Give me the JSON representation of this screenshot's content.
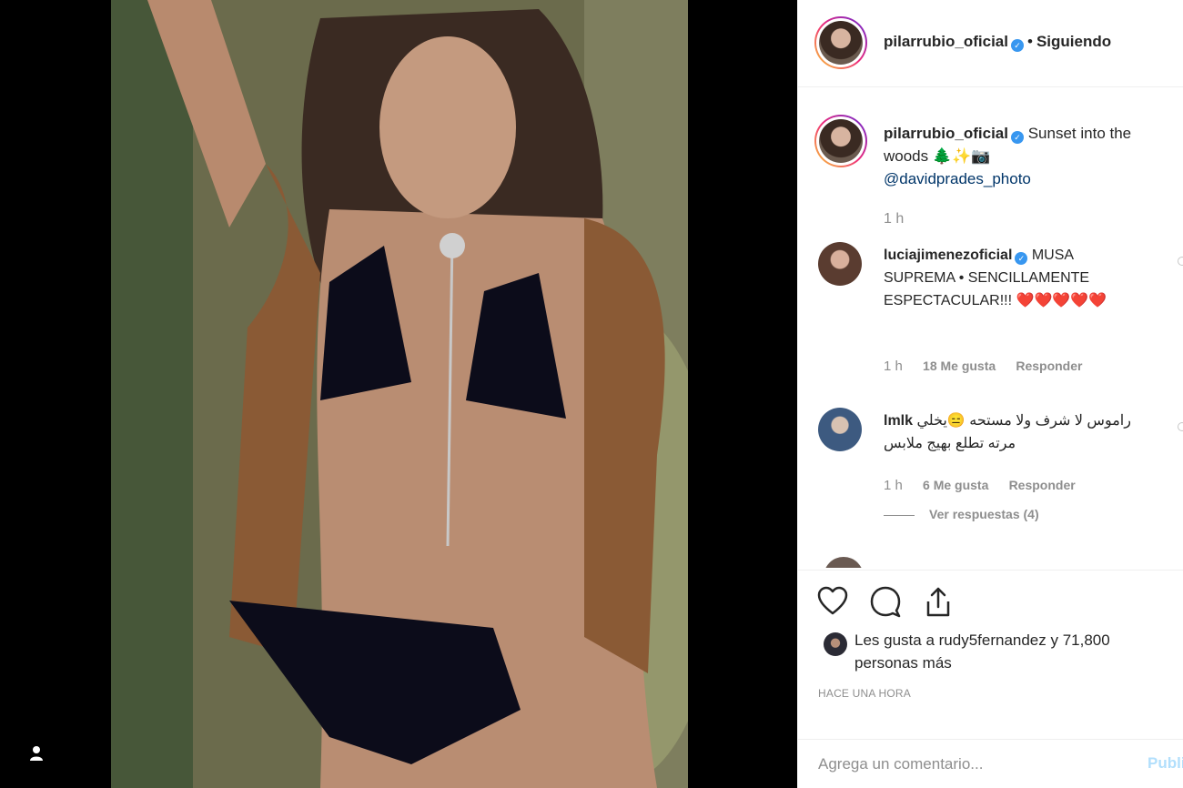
{
  "post": {
    "photo_alt": "",
    "author": {
      "username": "pilarrubio_oficial",
      "verified": true,
      "follow_status": "Siguiendo"
    },
    "caption": {
      "username": "pilarrubio_oficial",
      "text": "Sunset into the woods 🌲✨📷",
      "mention": "@davidprades_photo",
      "time": "1 h"
    },
    "comments": [
      {
        "username": "luciajimenezoficial",
        "verified": true,
        "text": "MUSA SUPREMA • SENCILLAMENTE ESPECTACULAR!!! ❤️❤️❤️❤️❤️",
        "time": "1 h",
        "likes": "18 Me gusta",
        "reply": "Responder"
      },
      {
        "username": "lmlk",
        "verified": false,
        "text": "راموس لا شرف ولا مستحه 😑يخلي مرته تطلع بهيج ملابس",
        "time": "1 h",
        "likes": "6 Me gusta",
        "reply": "Responder",
        "view_replies": "Ver respuestas (4)"
      }
    ],
    "likes_text": "Les gusta a rudy5fernandez y 71,800 personas más",
    "time_ago": "HACE UNA HORA",
    "comment_placeholder": "Agrega un comentario...",
    "publish_label": "Publicar"
  },
  "colors": {
    "link": "#003569",
    "verified": "#3897f0",
    "secondary_text": "#8e8e8e",
    "publish_disabled": "#b2dffc"
  },
  "icons": [
    "heart-icon",
    "comment-icon",
    "share-icon",
    "user-tag-icon",
    "verified-icon"
  ]
}
